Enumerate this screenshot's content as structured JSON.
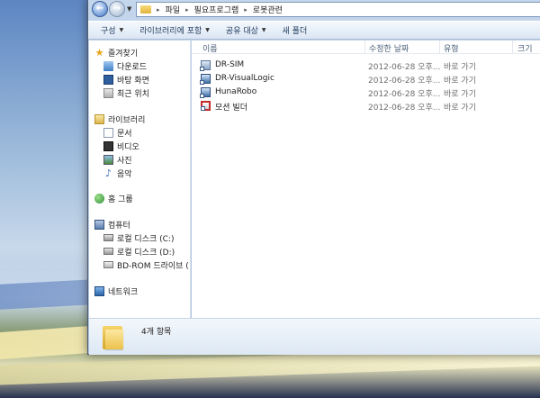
{
  "address": {
    "crumbs": [
      "파일",
      "필요프로그램",
      "로봇관련"
    ]
  },
  "toolbar": {
    "items": [
      {
        "label": "구성",
        "has_arrow": true
      },
      {
        "label": "라이브러리에 포함",
        "has_arrow": true
      },
      {
        "label": "공유 대상",
        "has_arrow": true
      },
      {
        "label": "새 폴더",
        "has_arrow": false
      }
    ]
  },
  "nav": {
    "favorites": {
      "label": "즐겨찾기",
      "items": [
        "다운로드",
        "바탕 화면",
        "최근 위치"
      ]
    },
    "libraries": {
      "label": "라이브러리",
      "items": [
        "문서",
        "비디오",
        "사진",
        "음악"
      ]
    },
    "homegroup": {
      "label": "홈 그룹"
    },
    "computer": {
      "label": "컴퓨터",
      "items": [
        "로컬 디스크 (C:)",
        "로컬 디스크 (D:)",
        "BD-ROM 드라이브 ("
      ]
    },
    "network": {
      "label": "네트워크"
    }
  },
  "columns": {
    "name": "이름",
    "modified": "수정한 날짜",
    "type": "유형",
    "size": "크기"
  },
  "files": [
    {
      "name": "DR-SIM",
      "modified": "2012-06-28 오후...",
      "type": "바로 가기",
      "icon": "shortcut-app-icon"
    },
    {
      "name": "DR-VisualLogic",
      "modified": "2012-06-28 오후...",
      "type": "바로 가기",
      "icon": "shortcut-app-icon"
    },
    {
      "name": "HunaRobo",
      "modified": "2012-06-28 오후...",
      "type": "바로 가기",
      "icon": "shortcut-app-icon"
    },
    {
      "name": "모션 빌더",
      "modified": "2012-06-28 오후...",
      "type": "바로 가기",
      "icon": "shortcut-motion-icon"
    }
  ],
  "details": {
    "count": "4개 항목"
  }
}
